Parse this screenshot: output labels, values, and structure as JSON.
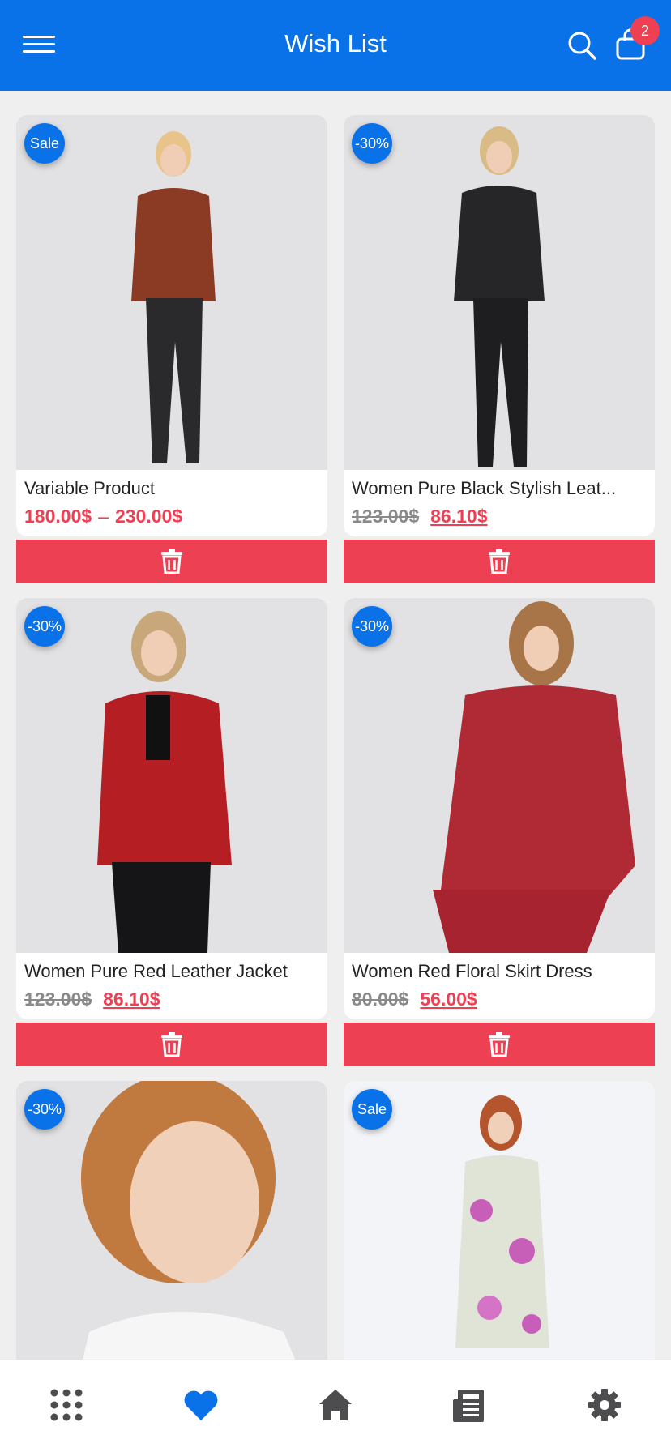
{
  "header": {
    "title": "Wish List",
    "cart_count": "2"
  },
  "colors": {
    "primary": "#0a72e8",
    "accent": "#ed4053",
    "background": "#efeff0"
  },
  "products": [
    {
      "badge": "Sale",
      "name": "Variable Product",
      "price_min": "180.00$",
      "price_sep": "–",
      "price_max": "230.00$"
    },
    {
      "badge": "-30%",
      "name": "Women Pure Black Stylish Leat...",
      "old_price": "123.00$",
      "new_price": "86.10$"
    },
    {
      "badge": "-30%",
      "name": "Women Pure Red Leather Jacket",
      "old_price": "123.00$",
      "new_price": "86.10$"
    },
    {
      "badge": "-30%",
      "name": "Women Red Floral Skirt Dress",
      "old_price": "80.00$",
      "new_price": "56.00$"
    },
    {
      "badge": "-30%"
    },
    {
      "badge": "Sale"
    }
  ],
  "bottom_nav": [
    {
      "icon": "grid-icon",
      "active": false
    },
    {
      "icon": "heart-icon",
      "active": true
    },
    {
      "icon": "home-icon",
      "active": false
    },
    {
      "icon": "news-icon",
      "active": false
    },
    {
      "icon": "gear-icon",
      "active": false
    }
  ]
}
